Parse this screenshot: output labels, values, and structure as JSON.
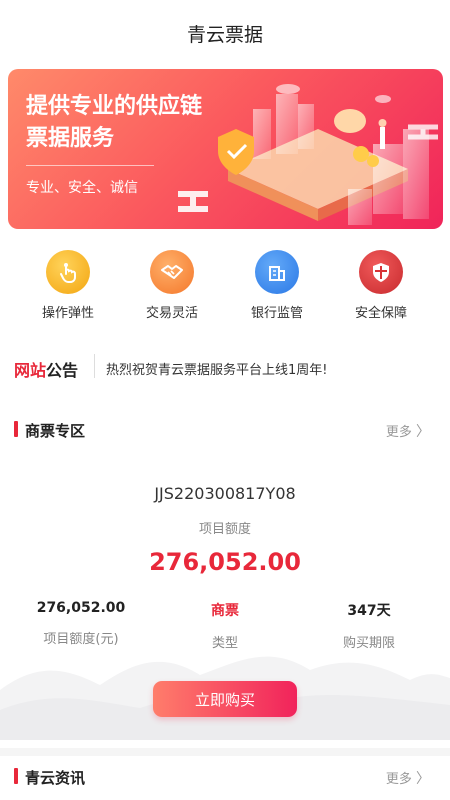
{
  "header": {
    "title": "青云票据"
  },
  "banner": {
    "headline_line1": "提供专业的供应链",
    "headline_line2": "票据服务",
    "subline": "专业、安全、诚信"
  },
  "features": [
    {
      "label": "操作弹性",
      "icon": "hand-tap-icon",
      "color": "#f8b51c"
    },
    {
      "label": "交易灵活",
      "icon": "handshake-icon",
      "color": "#f98a3a"
    },
    {
      "label": "银行监管",
      "icon": "bank-building-icon",
      "color": "#2f86f1"
    },
    {
      "label": "安全保障",
      "icon": "shield-icon",
      "color": "#e0303a"
    }
  ],
  "notice": {
    "tag_red": "网站",
    "tag_dark": "公告",
    "text": "热烈祝贺青云票据服务平台上线1周年!"
  },
  "section_commercial": {
    "title": "商票专区",
    "more": "更多"
  },
  "product": {
    "code": "JJS220300817Y08",
    "quota_label": "项目额度",
    "quota_value": "276,052.00",
    "stats": [
      {
        "value": "276,052.00",
        "label": "项目额度(元)"
      },
      {
        "value": "商票",
        "label": "类型"
      },
      {
        "value": "347天",
        "label": "购买期限"
      }
    ],
    "buy_label": "立即购买"
  },
  "section_news": {
    "title": "青云资讯",
    "more": "更多"
  },
  "colors": {
    "accent": "#e8283a",
    "gold": "#f8b51c",
    "orange": "#f98a3a",
    "blue": "#2f86f1"
  }
}
